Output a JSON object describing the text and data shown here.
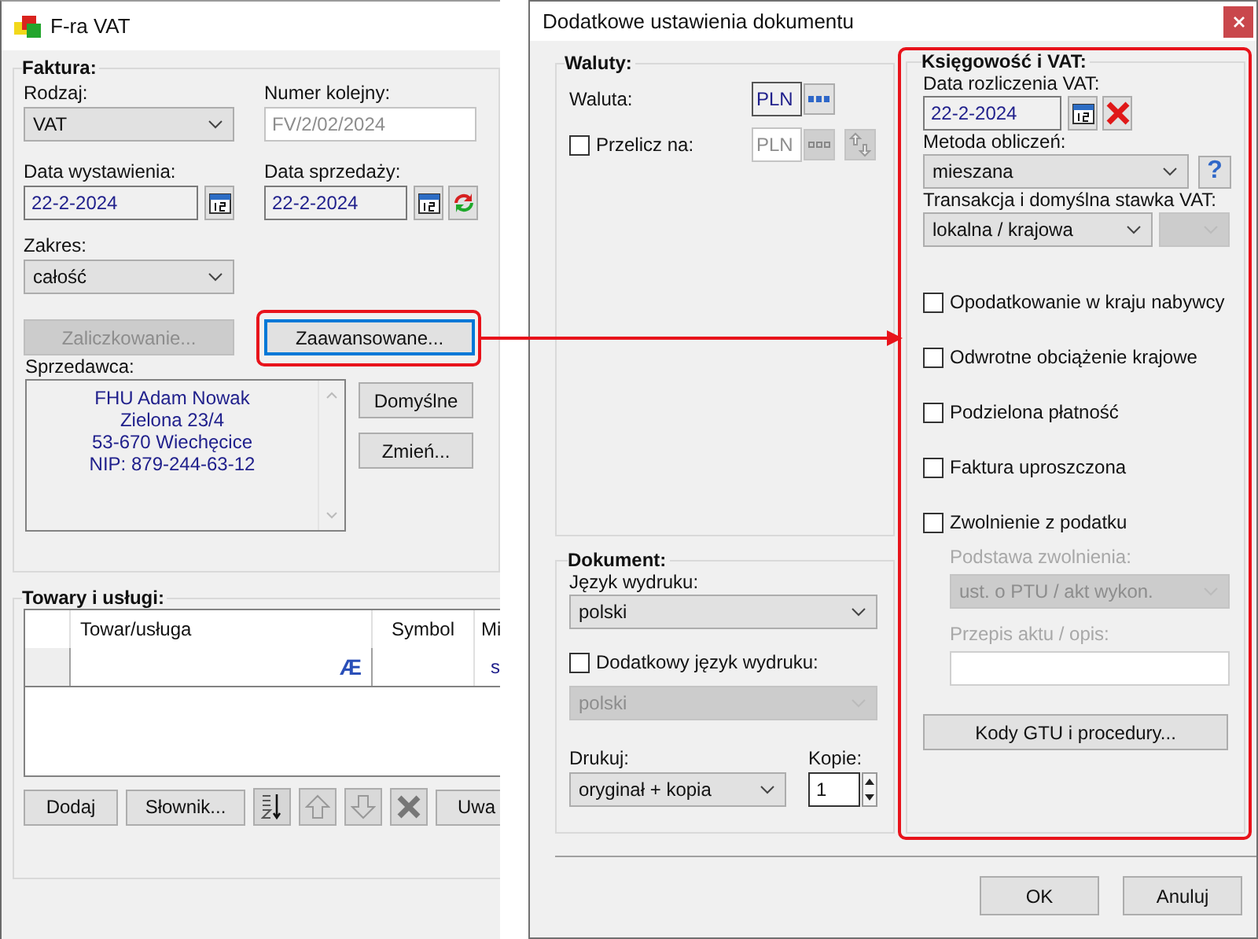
{
  "invoice_window": {
    "title": "F-ra VAT",
    "invoice": {
      "title": "Faktura:",
      "type": {
        "label": "Rodzaj:",
        "value": "VAT"
      },
      "number": {
        "label": "Numer kolejny:",
        "value": "FV/2/02/2024",
        "disabled": true
      },
      "issue_date": {
        "label": "Data wystawienia:",
        "value": "22-2-2024"
      },
      "sale_date": {
        "label": "Data sprzedaży:",
        "value": "22-2-2024"
      },
      "range": {
        "label": "Zakres:",
        "value": "całość"
      },
      "buttons": [
        {
          "label": "Zaliczkowanie...",
          "disabled": true,
          "focused": false
        },
        {
          "label": "Zaawansowane...",
          "disabled": false,
          "focused": true
        }
      ],
      "seller": {
        "label": "Sprzedawca:",
        "lines": [
          "FHU Adam Nowak",
          "Zielona 23/4",
          "53-670 Wiechęcice",
          "NIP: 879-244-63-12"
        ]
      },
      "seller_buttons": [
        "Domyślne",
        "Zmień..."
      ]
    },
    "items": {
      "title": "Towary i usługi:",
      "columns": [
        "Towar/usługa",
        "Symbol",
        "Mi"
      ],
      "filter_row": {
        "name_filter": "Æ",
        "unit_filter": "s"
      },
      "buttons": [
        {
          "kind": "text",
          "label": "Dodaj"
        },
        {
          "kind": "text",
          "label": "Słownik..."
        },
        {
          "kind": "sort"
        },
        {
          "kind": "up"
        },
        {
          "kind": "down"
        },
        {
          "kind": "delete"
        },
        {
          "kind": "text",
          "label": "Uwa"
        }
      ]
    }
  },
  "settings_window": {
    "title": "Dodatkowe ustawienia dokumentu",
    "currency": {
      "title": "Waluty:",
      "currency_label": "Waluta:",
      "currency_value": "PLN",
      "convert": {
        "label": "Przelicz na:",
        "checked": false,
        "value": "PLN"
      }
    },
    "document": {
      "title": "Dokument:",
      "language_label": "Język wydruku:",
      "language_value": "polski",
      "extra_language": {
        "label": "Dodatkowy język wydruku:",
        "checked": false,
        "value": "polski"
      },
      "print_label": "Drukuj:",
      "print_value": "oryginał + kopia",
      "copies_label": "Kopie:",
      "copies_value": "1"
    },
    "vat": {
      "title": "Księgowość i VAT:",
      "settlement_date_label": "Data rozliczenia VAT:",
      "settlement_date": "22-2-2024",
      "method_label": "Metoda obliczeń:",
      "method_value": "mieszana",
      "help_glyph": "?",
      "transaction_label": "Transakcja i domyślna stawka VAT:",
      "transaction_value": "lokalna / krajowa",
      "options": [
        {
          "label": "Opodatkowanie w kraju nabywcy",
          "checked": false
        },
        {
          "label": "Odwrotne obciążenie krajowe",
          "checked": false
        },
        {
          "label": "Podzielona płatność",
          "checked": false
        },
        {
          "label": "Faktura uproszczona",
          "checked": false
        },
        {
          "label": "Zwolnienie z podatku",
          "checked": false
        }
      ],
      "exemption_basis_label": "Podstawa zwolnienia:",
      "exemption_basis_value": "ust. o PTU / akt wykon.",
      "exemption_text_label": "Przepis aktu / opis:",
      "gtu_button": "Kody GTU i procedury..."
    },
    "buttons": [
      "OK",
      "Anuluj"
    ]
  }
}
